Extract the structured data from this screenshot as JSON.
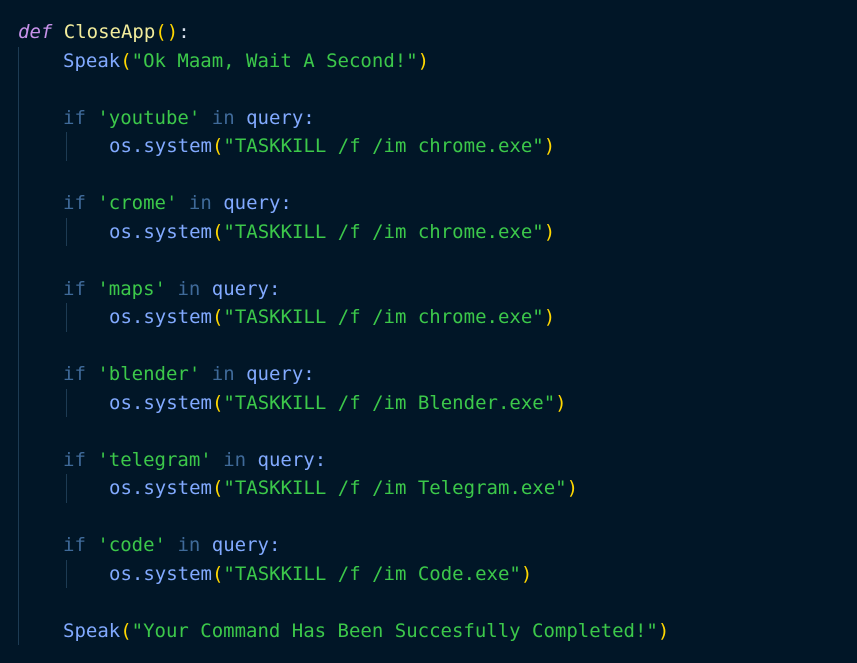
{
  "code": {
    "def_keyword": "def",
    "func_name": "CloseApp",
    "func_open": "(",
    "func_close": ")",
    "func_colon": ":",
    "speak_fn": "Speak",
    "speak_start_msg": "\"Ok Maam, Wait A Second!\"",
    "speak_end_msg": "\"Your Command Has Been Succesfully Completed!\"",
    "if_keyword": "if",
    "in_keyword": "in",
    "query_var": "query",
    "os_call": "os.system",
    "blocks": [
      {
        "key": "'youtube'",
        "cmd": "\"TASKKILL /f /im chrome.exe\""
      },
      {
        "key": "'crome'",
        "cmd": "\"TASKKILL /f /im chrome.exe\""
      },
      {
        "key": "'maps'",
        "cmd": "\"TASKKILL /f /im chrome.exe\""
      },
      {
        "key": "'blender'",
        "cmd": "\"TASKKILL /f /im Blender.exe\""
      },
      {
        "key": "'telegram'",
        "cmd": "\"TASKKILL /f /im Telegram.exe\""
      },
      {
        "key": "'code'",
        "cmd": "\"TASKKILL /f /im Code.exe\""
      }
    ]
  },
  "colors": {
    "background": "#011627",
    "keyword_def": "#c792ea",
    "keyword_control": "#3f6a99",
    "function_name": "#f2ec9c",
    "call": "#82aaff",
    "brace": "#ffd700",
    "string": "#3cc84a"
  }
}
